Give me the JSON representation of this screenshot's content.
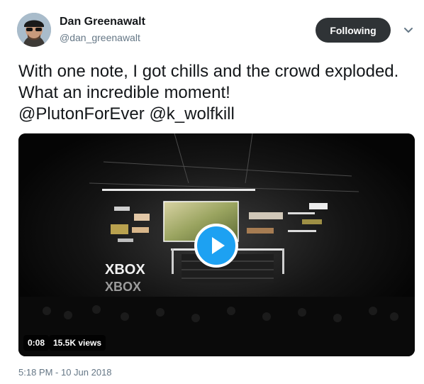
{
  "user": {
    "name": "Dan Greenawalt",
    "handle": "@dan_greenawalt"
  },
  "follow_button": {
    "label": "Following"
  },
  "menu": {
    "icon": "chevron-down-icon"
  },
  "tweet": {
    "text_parts": [
      "With one note, I got chills and the crowd exploded. What an incredible moment!",
      "@PlutonForEver",
      "@k_wolfkill"
    ],
    "timestamp": "5:18 PM - 10 Jun 2018"
  },
  "video": {
    "duration": "0:08",
    "views": "15.5K views",
    "play_icon": "play-icon",
    "stage_sign": "XBOX",
    "stage_sign_reflection": "XBOX"
  },
  "colors": {
    "accent": "#1da1f2",
    "button_bg": "#2f3336",
    "secondary_text": "#657786"
  }
}
